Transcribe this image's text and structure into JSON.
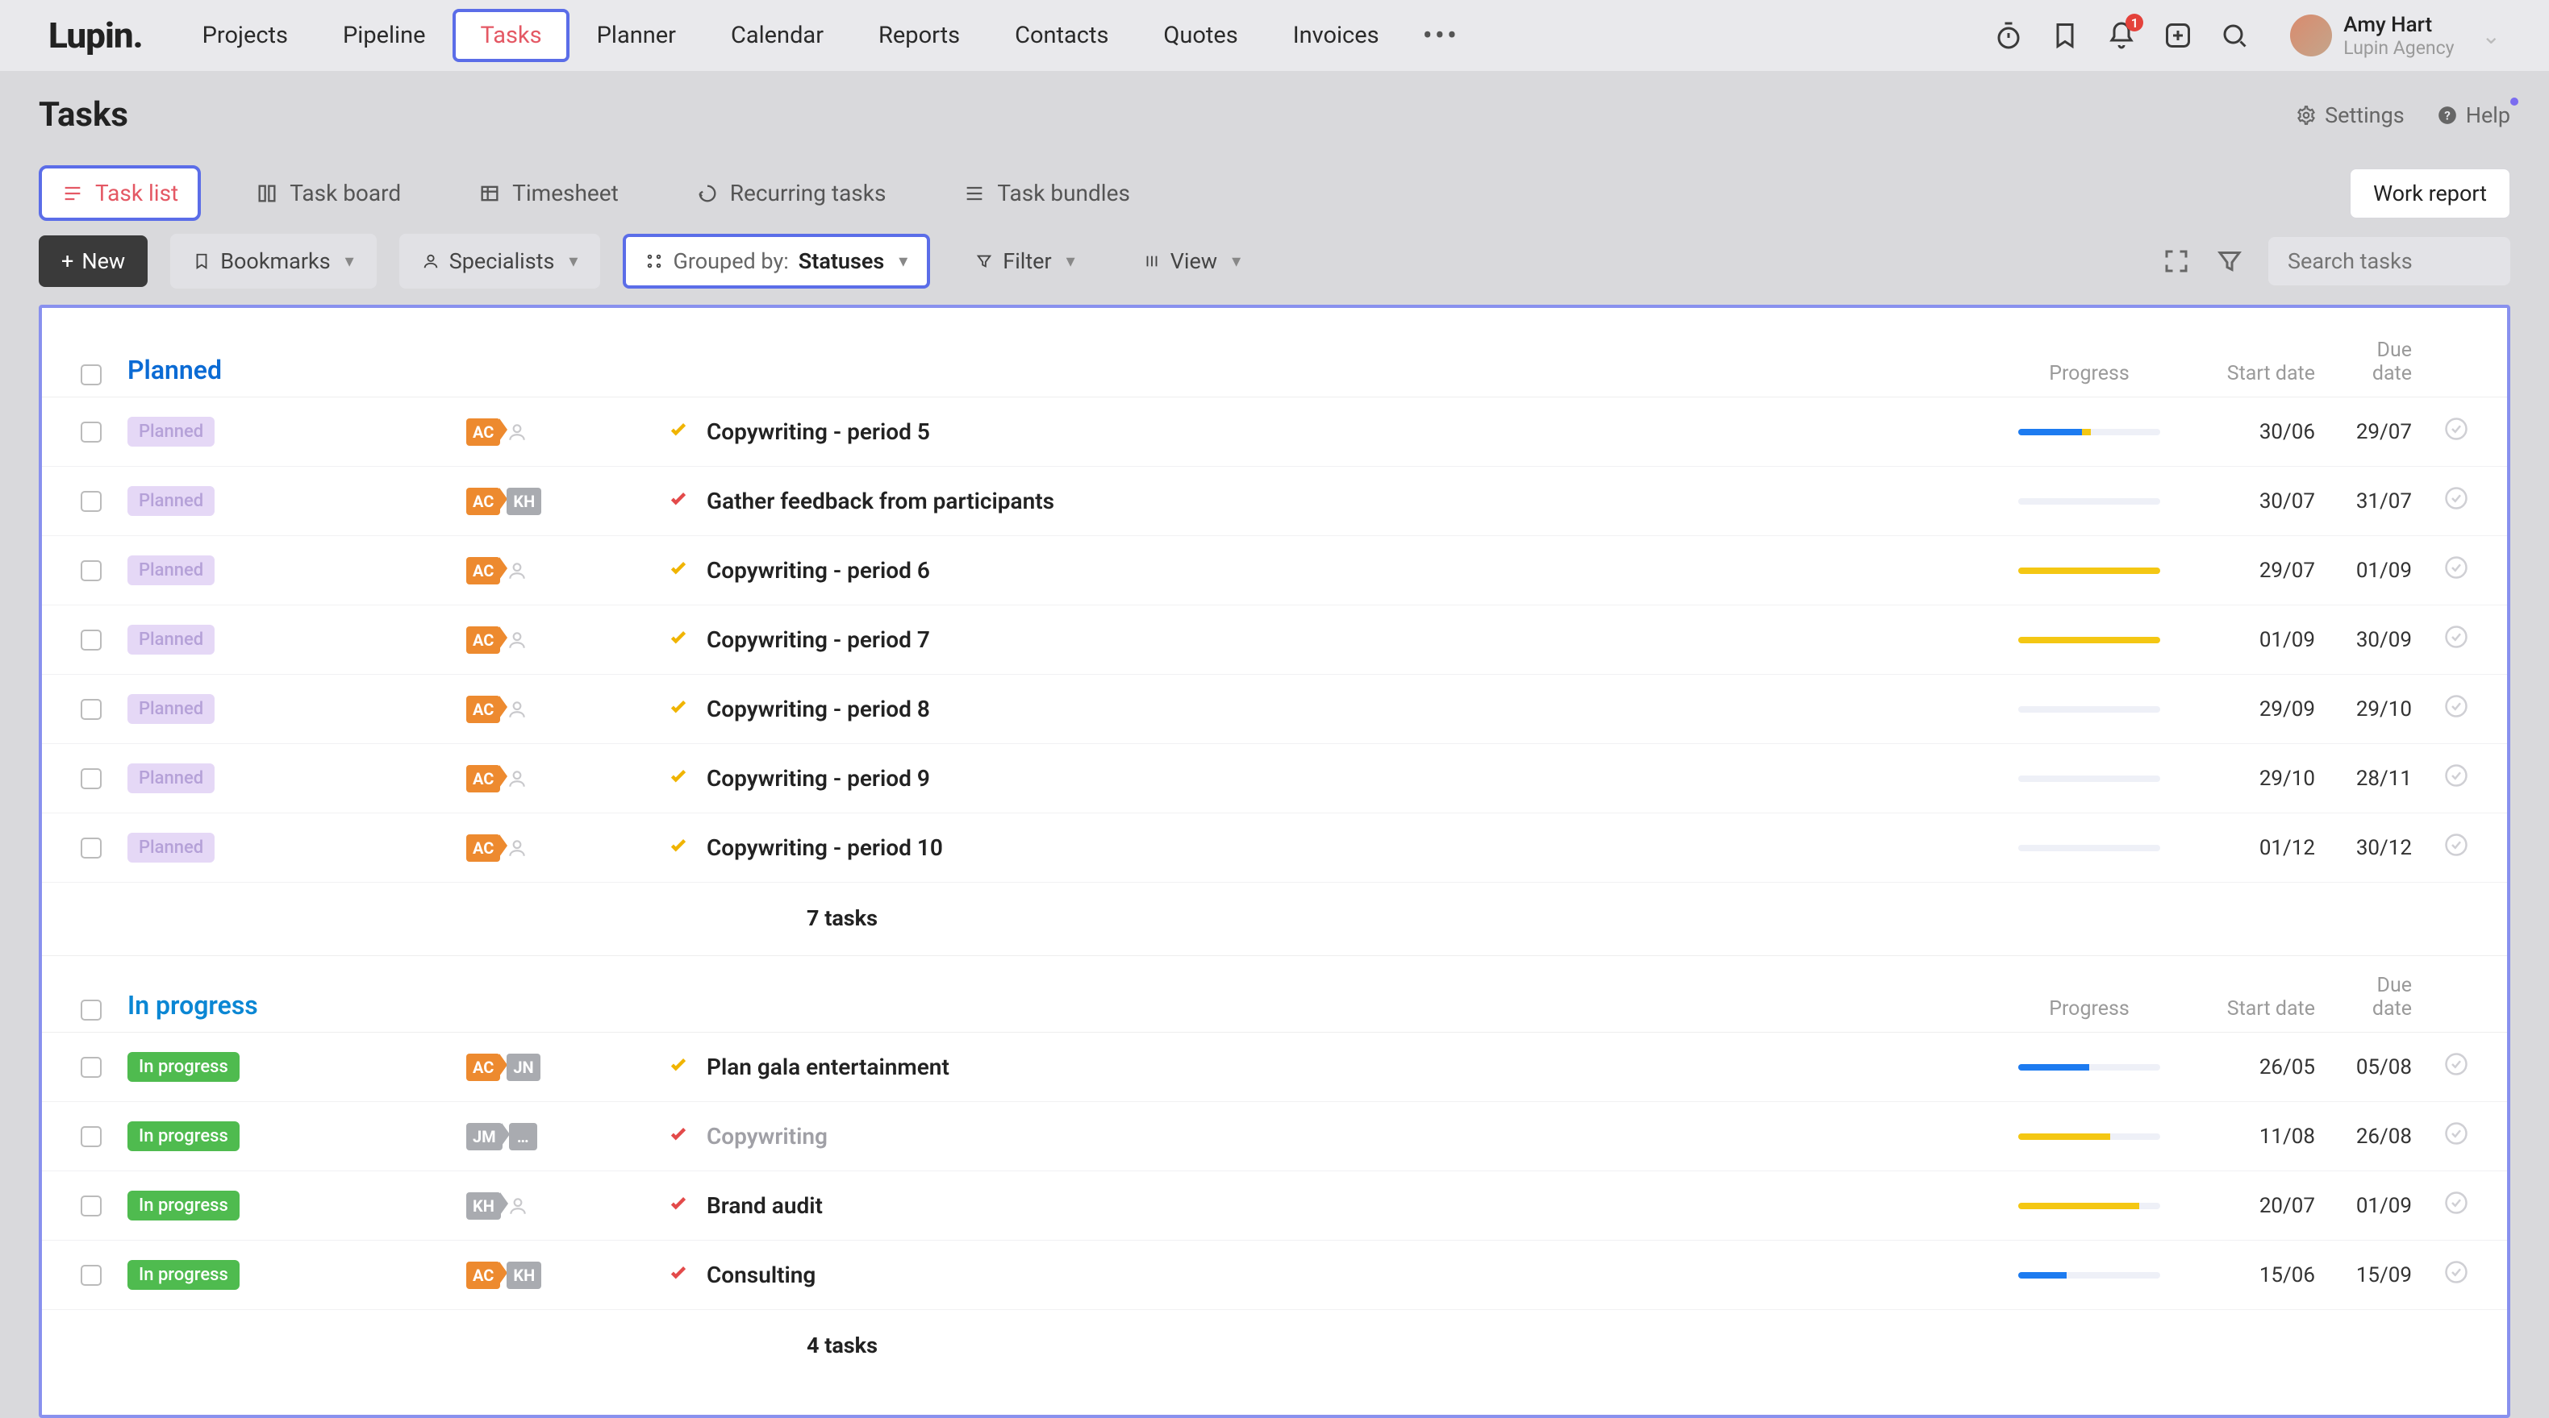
{
  "app": {
    "logo": "Lupin."
  },
  "nav": {
    "items": [
      "Projects",
      "Pipeline",
      "Tasks",
      "Planner",
      "Calendar",
      "Reports",
      "Contacts",
      "Quotes",
      "Invoices"
    ],
    "activeIndex": 2,
    "notificationCount": "1"
  },
  "user": {
    "name": "Amy Hart",
    "org": "Lupin Agency"
  },
  "page": {
    "title": "Tasks",
    "settings": "Settings",
    "help": "Help"
  },
  "subtabs": {
    "items": [
      "Task list",
      "Task board",
      "Timesheet",
      "Recurring tasks",
      "Task bundles"
    ],
    "activeIndex": 0,
    "workReport": "Work report"
  },
  "toolbar": {
    "newLabel": "New",
    "bookmarks": "Bookmarks",
    "specialists": "Specialists",
    "groupedPrefix": "Grouped by:",
    "groupedValue": "Statuses",
    "filter": "Filter",
    "view": "View",
    "searchPlaceholder": "Search tasks"
  },
  "columns": {
    "progress": "Progress",
    "start": "Start date",
    "due": "Due date"
  },
  "groups": [
    {
      "name": "Planned",
      "class": "planned",
      "count": "7 tasks",
      "rows": [
        {
          "status": "Planned",
          "statusClass": "p",
          "assignees": [
            {
              "t": "AC",
              "c": "ac",
              "arrow": true
            }
          ],
          "personIcon": true,
          "mark": "yellow",
          "title": "Copywriting - period 5",
          "muted": false,
          "bars": [
            {
              "c": "blue",
              "w": 45
            },
            {
              "c": "yellow",
              "w": 6
            }
          ],
          "start": "30/06",
          "due": "29/07"
        },
        {
          "status": "Planned",
          "statusClass": "p",
          "assignees": [
            {
              "t": "AC",
              "c": "ac",
              "arrow": true
            },
            {
              "t": "KH",
              "c": "kh"
            }
          ],
          "personIcon": false,
          "mark": "red",
          "title": "Gather feedback from participants",
          "muted": false,
          "bars": [],
          "start": "30/07",
          "due": "31/07"
        },
        {
          "status": "Planned",
          "statusClass": "p",
          "assignees": [
            {
              "t": "AC",
              "c": "ac",
              "arrow": true
            }
          ],
          "personIcon": true,
          "mark": "yellow",
          "title": "Copywriting - period 6",
          "muted": false,
          "bars": [
            {
              "c": "yellow",
              "w": 100
            }
          ],
          "start": "29/07",
          "due": "01/09"
        },
        {
          "status": "Planned",
          "statusClass": "p",
          "assignees": [
            {
              "t": "AC",
              "c": "ac",
              "arrow": true
            }
          ],
          "personIcon": true,
          "mark": "yellow",
          "title": "Copywriting - period 7",
          "muted": false,
          "bars": [
            {
              "c": "yellow",
              "w": 100
            }
          ],
          "start": "01/09",
          "due": "30/09"
        },
        {
          "status": "Planned",
          "statusClass": "p",
          "assignees": [
            {
              "t": "AC",
              "c": "ac",
              "arrow": true
            }
          ],
          "personIcon": true,
          "mark": "yellow",
          "title": "Copywriting - period 8",
          "muted": false,
          "bars": [],
          "start": "29/09",
          "due": "29/10"
        },
        {
          "status": "Planned",
          "statusClass": "p",
          "assignees": [
            {
              "t": "AC",
              "c": "ac",
              "arrow": true
            }
          ],
          "personIcon": true,
          "mark": "yellow",
          "title": "Copywriting - period 9",
          "muted": false,
          "bars": [],
          "start": "29/10",
          "due": "28/11"
        },
        {
          "status": "Planned",
          "statusClass": "p",
          "assignees": [
            {
              "t": "AC",
              "c": "ac",
              "arrow": true
            }
          ],
          "personIcon": true,
          "mark": "yellow",
          "title": "Copywriting - period 10",
          "muted": false,
          "bars": [],
          "start": "01/12",
          "due": "30/12"
        }
      ]
    },
    {
      "name": "In progress",
      "class": "inprogress",
      "count": "4 tasks",
      "rows": [
        {
          "status": "In progress",
          "statusClass": "ip",
          "assignees": [
            {
              "t": "AC",
              "c": "ac",
              "arrow": true
            },
            {
              "t": "JN",
              "c": "jn"
            }
          ],
          "personIcon": false,
          "mark": "yellow",
          "title": "Plan gala entertainment",
          "muted": false,
          "bars": [
            {
              "c": "blue",
              "w": 50
            }
          ],
          "start": "26/05",
          "due": "05/08"
        },
        {
          "status": "In progress",
          "statusClass": "ip",
          "assignees": [
            {
              "t": "JM",
              "c": "jm",
              "arrow": true
            },
            {
              "t": "…",
              "c": "dots"
            }
          ],
          "personIcon": false,
          "mark": "red",
          "title": "Copywriting",
          "muted": true,
          "bars": [
            {
              "c": "yellow",
              "w": 65
            }
          ],
          "start": "11/08",
          "due": "26/08"
        },
        {
          "status": "In progress",
          "statusClass": "ip",
          "assignees": [
            {
              "t": "KH",
              "c": "kh",
              "arrow": true
            }
          ],
          "personIcon": true,
          "mark": "red",
          "title": "Brand audit",
          "muted": false,
          "bars": [
            {
              "c": "yellow",
              "w": 85
            }
          ],
          "start": "20/07",
          "due": "01/09"
        },
        {
          "status": "In progress",
          "statusClass": "ip",
          "assignees": [
            {
              "t": "AC",
              "c": "ac",
              "arrow": true
            },
            {
              "t": "KH",
              "c": "kh"
            }
          ],
          "personIcon": false,
          "mark": "red",
          "title": "Consulting",
          "muted": false,
          "bars": [
            {
              "c": "blue",
              "w": 34
            }
          ],
          "start": "15/06",
          "due": "15/09"
        }
      ]
    }
  ]
}
